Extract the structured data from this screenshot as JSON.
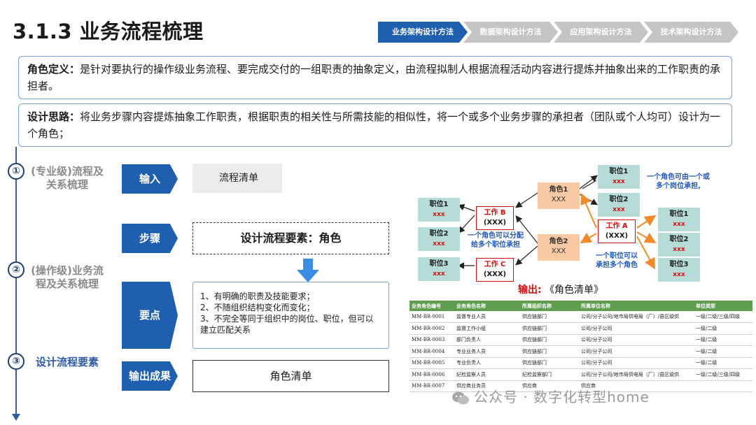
{
  "header": {
    "title": "3.1.3 业务流程梳理",
    "steps": [
      "业务架构设计方法",
      "数据架构设计方法",
      "应用架构设计方法",
      "技术架构设计方法"
    ],
    "active_step": 0,
    "colors": {
      "active": "#1f5fb0",
      "inactive": "#c4c4c4"
    }
  },
  "definitions": {
    "role_label": "角色定义：",
    "role_text": "是针对要执行的操作级业务流程、要完成交付的一组职责的抽象定义，由流程拟制人根据流程活动内容进行提炼并抽象出来的工作职责的承担者。",
    "idea_label": "设计思路：",
    "idea_text": "将业务步骤内容提炼抽象工作职责，根据职责的相关性与所需技能的相似性，将一个或多个业务步骤的承担者（团队或个人均可）设计为一个角色；"
  },
  "timeline": [
    {
      "num": "①",
      "label": "(专业级)流程及关系梳理"
    },
    {
      "num": "②",
      "label": "(操作级)业务流程及关系梳理"
    },
    {
      "num": "③",
      "label": "设计流程要素"
    }
  ],
  "process": {
    "input_label": "输入",
    "input_value": "流程清单",
    "step_label": "步骤",
    "step_value": "设计流程要素：角色",
    "points_label": "要点",
    "points": [
      "1、有明确的职责及技能要求；",
      "2、不随组织结构变化而变化；",
      "3、不完全等同于组织中的岗位、职位，但可以建立匹配关系"
    ],
    "output_label": "输出成果",
    "output_value": "角色清单"
  },
  "diagram": {
    "post": "职位",
    "xxx": "xxx",
    "XXX": "XXX",
    "role1": "角色1",
    "role2": "角色2",
    "work_a": "工作 A",
    "work_b": "工作 B",
    "work_c": "工作 C",
    "work_xxx": "(XXX)",
    "p1": "职位1",
    "p2": "职位2",
    "p3": "职位3",
    "note_top": "一个角色可由一个或多个岗位承担,",
    "note_mid": "一个角色可以分配给多个职位承担",
    "note_right": "一个职位可以承担多个角色",
    "output_prefix": "输出:",
    "output_name": "《角色清单》"
  },
  "table": {
    "headers": [
      "业务角色编号",
      "业务角色名称",
      "所属组织名称",
      "所属单位名称",
      "单位类型"
    ],
    "rows": [
      [
        "MM-BR-0001",
        "监督专业人员",
        "供应链部门",
        "公司/分子公司/地市局供电局（厂）/县区级供",
        "一级/二级/三级/四级"
      ],
      [
        "MM-BR-0002",
        "监督工作小组",
        "供应链部门",
        "公司/分子公司",
        "一级/二级"
      ],
      [
        "MM-BR-0003",
        "部门负责人",
        "供应链部门",
        "公司/分子公司",
        "一级/二级"
      ],
      [
        "MM-BR-0004",
        "专业业务人员",
        "供应链部门",
        "公司/分子公司",
        "一级/二级"
      ],
      [
        "MM-BR-0005",
        "专业负责人",
        "供应链部门",
        "公司/分子公司",
        "一级/二级"
      ],
      [
        "MM-BR-0006",
        "纪检监察人员",
        "纪检监察部门",
        "公司/分子公司/地市局供电局（厂）/县区级供",
        "一级/二级/三级/四级"
      ],
      [
        "MM-BR-0007",
        "供应商业务员",
        "供应商",
        "供应商",
        ""
      ]
    ]
  },
  "watermark": "公众号 · 数字化转型home"
}
